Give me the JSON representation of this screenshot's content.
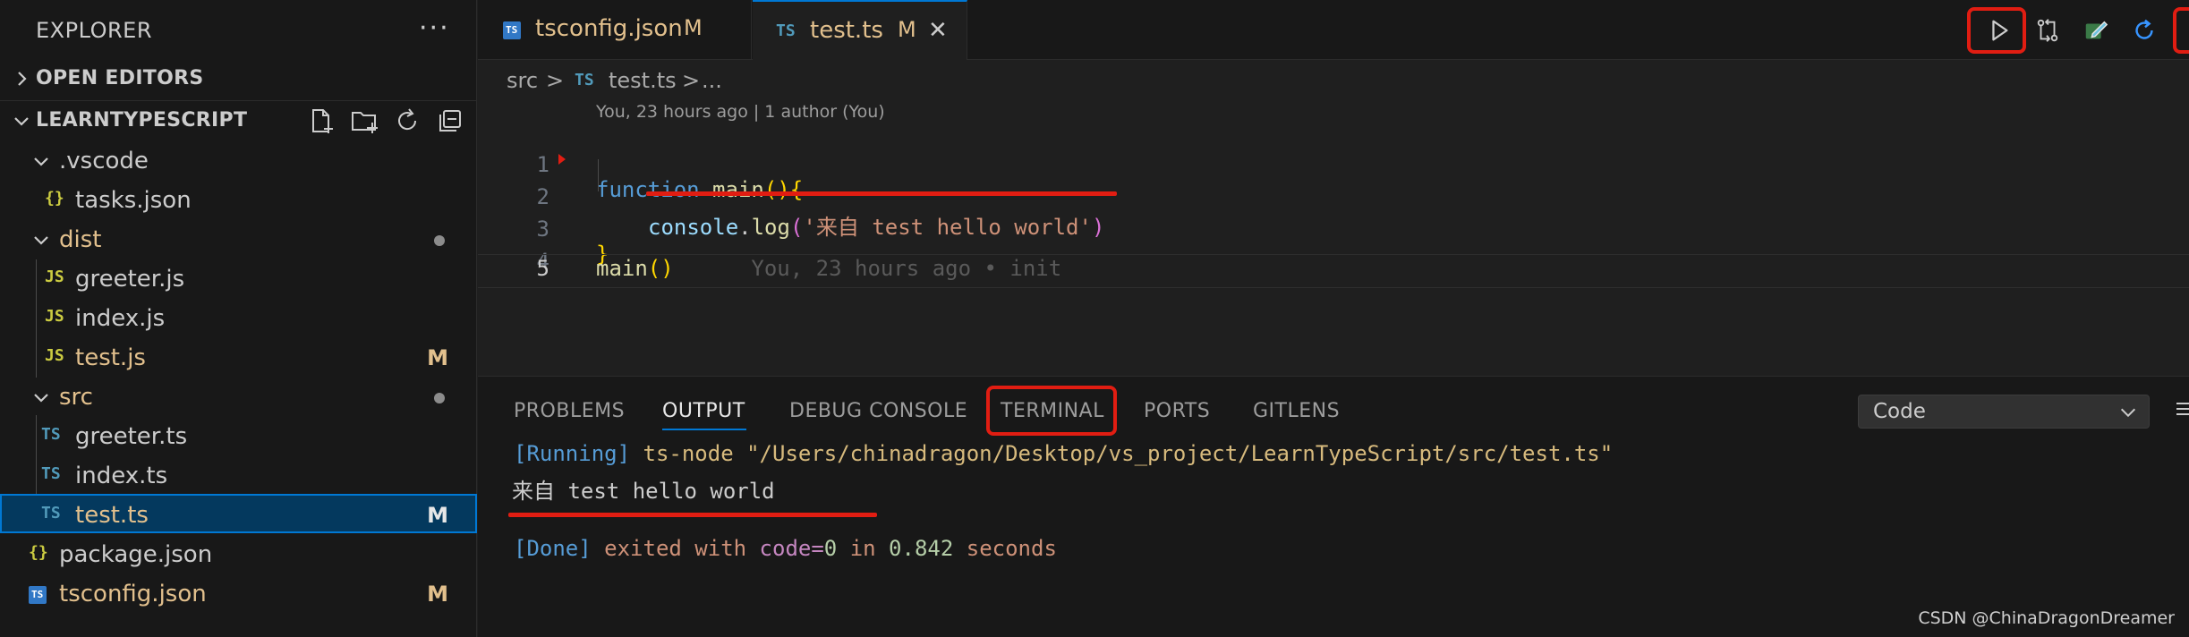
{
  "sidebar": {
    "title": "EXPLORER",
    "more_label": "···",
    "open_editors": "OPEN EDITORS",
    "project": "LEARNTYPESCRIPT",
    "tree": [
      {
        "name": ".vscode",
        "icon": "",
        "badge": ""
      },
      {
        "name": "tasks.json",
        "icon": "{}",
        "badge": ""
      },
      {
        "name": "dist",
        "icon": "",
        "badge": ""
      },
      {
        "name": "greeter.js",
        "icon": "JS",
        "badge": ""
      },
      {
        "name": "index.js",
        "icon": "JS",
        "badge": ""
      },
      {
        "name": "test.js",
        "icon": "JS",
        "badge": "M"
      },
      {
        "name": "src",
        "icon": "",
        "badge": ""
      },
      {
        "name": "greeter.ts",
        "icon": "TS",
        "badge": ""
      },
      {
        "name": "index.ts",
        "icon": "TS",
        "badge": ""
      },
      {
        "name": "test.ts",
        "icon": "TS",
        "badge": "M"
      },
      {
        "name": "package.json",
        "icon": "{}",
        "badge": ""
      },
      {
        "name": "tsconfig.json",
        "icon": "TS",
        "badge": "M"
      }
    ]
  },
  "tabs": [
    {
      "name": "tsconfig.json",
      "badge": "M",
      "icon": "TS"
    },
    {
      "name": "test.ts",
      "badge": "M",
      "icon": "TS",
      "close": "✕"
    }
  ],
  "breadcrumb": {
    "folder": "src",
    "icon": "TS",
    "file": "test.ts",
    "sep": ">",
    "more": "..."
  },
  "editor": {
    "blame_header": "You, 23 hours ago | 1 author (You)",
    "line_numbers": [
      "1",
      "2",
      "3",
      "4",
      "5"
    ],
    "line1": {
      "kw": "function",
      "fn": "main",
      "parens": "()",
      "brace": "{"
    },
    "line2": {
      "obj": "console",
      "dot": ".",
      "method": "log",
      "open": "(",
      "str": "'来自 test hello world'",
      "close": ")"
    },
    "line3": {
      "brace": "}"
    },
    "line5": {
      "fn": "main",
      "parens": "()",
      "blame": "You, 23 hours ago • init"
    }
  },
  "panel": {
    "tabs": [
      "PROBLEMS",
      "OUTPUT",
      "DEBUG CONSOLE",
      "TERMINAL",
      "PORTS",
      "GITLENS"
    ],
    "active_tab": "OUTPUT",
    "channel": "Code",
    "output": {
      "running_tag": "[Running]",
      "running_cmd": " ts-node \"/Users/chinadragon/Desktop/vs_project/LearnTypeScript/src/test.ts\"",
      "result": "来自 test hello world",
      "done_tag": "[Done]",
      "done_1": " exited with ",
      "done_code_key": "code=",
      "done_code_val": "0",
      "done_in": " in ",
      "done_time": "0.842",
      "done_seconds": " seconds"
    }
  },
  "watermark": "CSDN @ChinaDragonDreamer",
  "colors": {
    "accent": "#0078d4",
    "highlight": "#e11d12",
    "modified": "#e2c08d",
    "ts_icon": "#519aba",
    "js_icon": "#cbcb41",
    "json_icon": "#cbcb41"
  }
}
